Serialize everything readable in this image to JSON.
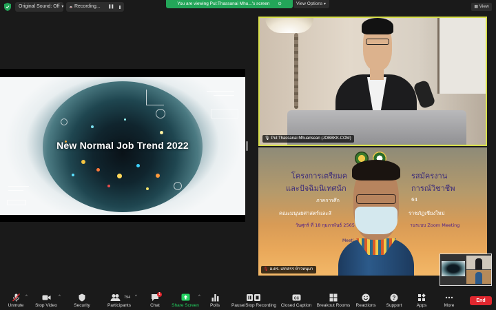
{
  "topbar": {
    "original_sound": "Original Sound: Off",
    "recording": "Recording...",
    "share_banner": "You are viewing Pul:Thassanai Mhu...'s screen",
    "view_options": "View Options",
    "view": "View"
  },
  "share": {
    "title": "New Normal Job Trend 2022"
  },
  "tiles": [
    {
      "name": "Pul:Thassanai Mhuansean (JOBBKK.COM)"
    },
    {
      "name": "อ.ดร. เสกสรร ห้าวหนุมา",
      "slide_lines": [
        "โครงการเตรียมค",
        "รสมัครงาน",
        "และปัจฉิมนิเทศนัก",
        "การณ์วิชาชีพ",
        "ภาคการศึก",
        "64",
        "คณะมนุษยศาสตร์และสั",
        "ราชภัฏเชียงใหม่",
        "วันศุกร์ ที่ 18 กุมภาพันธ์ 2565",
        "านระบบ Zoom Meeting",
        "Meeti"
      ]
    }
  ],
  "toolbar": {
    "unmute": "Unmute",
    "stop_video": "Stop Video",
    "security": "Security",
    "participants": "Participants",
    "participants_count": "794",
    "chat": "Chat",
    "chat_badge": "1",
    "share_screen": "Share Screen",
    "polls": "Polls",
    "pause_recording": "Pause/Stop Recording",
    "closed_caption": "Closed Caption",
    "breakout_rooms": "Breakout Rooms",
    "reactions": "Reactions",
    "support": "Support",
    "apps": "Apps",
    "more": "More",
    "end": "End"
  },
  "colors": {
    "share_banner": "#23a659",
    "active_speaker_border": "#d8e04b",
    "end_button": "#e0272f",
    "share_screen_icon": "#23d160"
  }
}
